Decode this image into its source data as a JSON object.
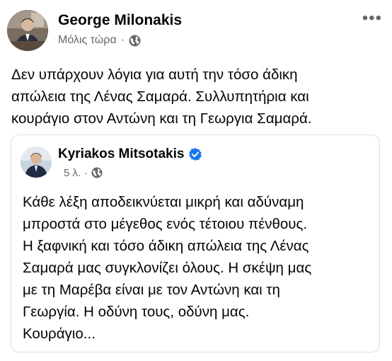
{
  "post": {
    "author": "George Milonakis",
    "time": "Μόλις τώρα",
    "separator": "·",
    "privacy_icon": "globe-icon",
    "more_label": "•••",
    "text": "Δεν υπάρχουν λόγια για αυτή την τόσο άδικη\nαπώλεια της Λένας Σαμαρά. Συλλυπητήρια και\nκουράγιο στον Αντώνη και τη Γεωργια Σαμαρά."
  },
  "shared_post": {
    "author": "Kyriakos Mitsotakis",
    "verified_icon": "verified-badge-icon",
    "time": "5 λ.",
    "separator": "·",
    "privacy_icon": "globe-icon",
    "text": "Κάθε λέξη αποδεικνύεται μικρή και αδύναμη\nμπροστά στο μέγεθος ενός τέτοιου πένθους.\nΗ ξαφνική και τόσο άδικη απώλεια της Λένας\nΣαμαρά μας συγκλονίζει όλους. Η σκέψη μας\nμε τη Μαρέβα είναι με τον Αντώνη και τη\nΓεωργία. Η οδύνη τους, οδύνη μας.\nΚουράγιο..."
  },
  "colors": {
    "text": "#050505",
    "secondary": "#65676b",
    "verified": "#1877f2",
    "border": "#dadde1"
  }
}
